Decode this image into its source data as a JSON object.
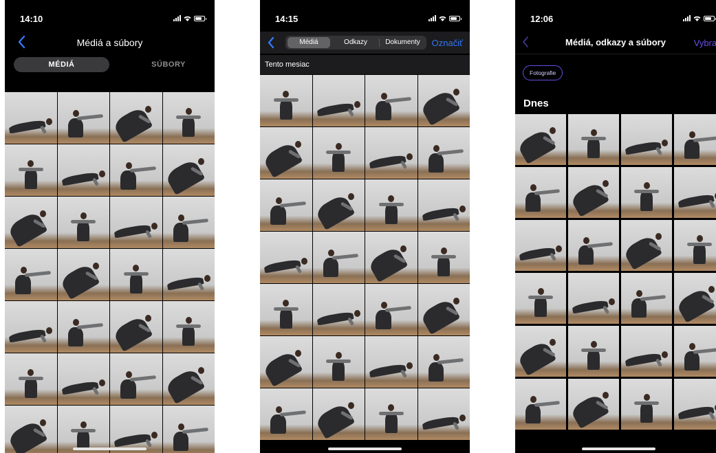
{
  "phone1": {
    "time": "14:10",
    "title": "Médiá a súbory",
    "tab_active": "MÉDIÁ",
    "tab_inactive": "SÚBORY",
    "photo_count": 28
  },
  "phone2": {
    "time": "14:15",
    "tabs": [
      "Médiá",
      "Odkazy",
      "Dokumenty"
    ],
    "action": "Označiť",
    "section": "Tento mesiac",
    "photo_count": 28,
    "accent": "#3478f6"
  },
  "phone3": {
    "time": "12:06",
    "title": "Médiá, odkazy a súbory",
    "action": "Vybrať",
    "filter_chip": "Fotografie",
    "section": "Dnes",
    "photo_count": 24,
    "accent": "#6a4de8"
  }
}
